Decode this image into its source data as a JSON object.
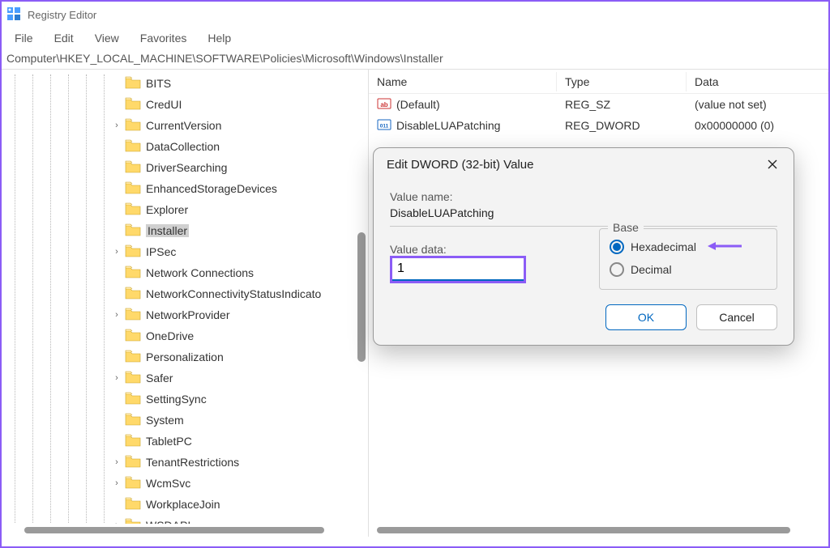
{
  "window": {
    "title": "Registry Editor"
  },
  "menu": {
    "file": "File",
    "edit": "Edit",
    "view": "View",
    "favorites": "Favorites",
    "help": "Help"
  },
  "address": "Computer\\HKEY_LOCAL_MACHINE\\SOFTWARE\\Policies\\Microsoft\\Windows\\Installer",
  "tree": {
    "items": [
      {
        "label": "BITS",
        "expandable": false
      },
      {
        "label": "CredUI",
        "expandable": false
      },
      {
        "label": "CurrentVersion",
        "expandable": true
      },
      {
        "label": "DataCollection",
        "expandable": false
      },
      {
        "label": "DriverSearching",
        "expandable": false
      },
      {
        "label": "EnhancedStorageDevices",
        "expandable": false
      },
      {
        "label": "Explorer",
        "expandable": false
      },
      {
        "label": "Installer",
        "expandable": false,
        "selected": true
      },
      {
        "label": "IPSec",
        "expandable": true
      },
      {
        "label": "Network Connections",
        "expandable": false
      },
      {
        "label": "NetworkConnectivityStatusIndicato",
        "expandable": false
      },
      {
        "label": "NetworkProvider",
        "expandable": true
      },
      {
        "label": "OneDrive",
        "expandable": false
      },
      {
        "label": "Personalization",
        "expandable": false
      },
      {
        "label": "Safer",
        "expandable": true
      },
      {
        "label": "SettingSync",
        "expandable": false
      },
      {
        "label": "System",
        "expandable": false
      },
      {
        "label": "TabletPC",
        "expandable": false
      },
      {
        "label": "TenantRestrictions",
        "expandable": true
      },
      {
        "label": "WcmSvc",
        "expandable": true
      },
      {
        "label": "WorkplaceJoin",
        "expandable": false
      },
      {
        "label": "WSDAPI",
        "expandable": true
      }
    ]
  },
  "values": {
    "columns": {
      "name": "Name",
      "type": "Type",
      "data": "Data"
    },
    "rows": [
      {
        "icon": "string",
        "name": "(Default)",
        "type": "REG_SZ",
        "data": "(value not set)"
      },
      {
        "icon": "dword",
        "name": "DisableLUAPatching",
        "type": "REG_DWORD",
        "data": "0x00000000 (0)"
      }
    ]
  },
  "dialog": {
    "title": "Edit DWORD (32-bit) Value",
    "value_name_label": "Value name:",
    "value_name": "DisableLUAPatching",
    "value_data_label": "Value data:",
    "value_data": "1",
    "base_label": "Base",
    "radio_hex": "Hexadecimal",
    "radio_dec": "Decimal",
    "selected_base": "Hexadecimal",
    "ok": "OK",
    "cancel": "Cancel"
  }
}
